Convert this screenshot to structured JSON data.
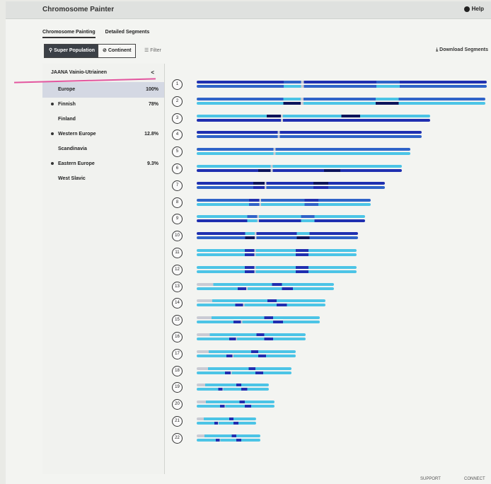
{
  "app": {
    "title": "Chromosome Painter",
    "help": "Help"
  },
  "tabs": [
    "Chromosome Painting",
    "Detailed Segments"
  ],
  "toolbar": {
    "super_population": "Super Population",
    "continent": "Continent",
    "filter": "Filter",
    "download": "Download Segments"
  },
  "sidebar": {
    "person": "JAANA Vainio-Utriainen",
    "collapse": "<",
    "populations": [
      {
        "name": "Europe",
        "percent": "100%",
        "dot": false,
        "selected": true
      },
      {
        "name": "Finnish",
        "percent": "78%",
        "dot": true,
        "selected": false
      },
      {
        "name": "Finland",
        "percent": "",
        "dot": false,
        "selected": false
      },
      {
        "name": "Western Europe",
        "percent": "12.8%",
        "dot": true,
        "selected": false
      },
      {
        "name": "Scandinavia",
        "percent": "",
        "dot": false,
        "selected": false
      },
      {
        "name": "Eastern Europe",
        "percent": "9.3%",
        "dot": true,
        "selected": false
      },
      {
        "name": "West Slavic",
        "percent": "",
        "dot": false,
        "selected": false
      }
    ]
  },
  "chromosomes": [
    "1",
    "2",
    "3",
    "4",
    "5",
    "6",
    "7",
    "8",
    "9",
    "10",
    "11",
    "12",
    "13",
    "14",
    "15",
    "16",
    "17",
    "18",
    "19",
    "20",
    "21",
    "22"
  ],
  "colors": {
    "dark_blue": "#1f2fb0",
    "mid_blue": "#2f63c8",
    "cyan": "#4cc4e6",
    "light": "#c9cbd4",
    "navy": "#0c145a"
  },
  "footer": {
    "support": "SUPPORT",
    "connect": "CONNECT"
  }
}
